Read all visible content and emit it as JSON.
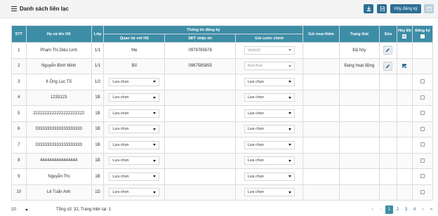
{
  "header": {
    "title": "Danh sách liên lạc",
    "buttons": {
      "cancel_label": "Hủy đăng ký"
    }
  },
  "table": {
    "headers": {
      "stt": "STT",
      "name": "Họ và tên HS",
      "class": "Lớp",
      "group": "Thông tin đăng ký",
      "relation": "Quan hệ với HS",
      "phone": "SĐT nhận tin",
      "package": "Gói cước chính",
      "extra": "Gói mua thêm",
      "status": "Trạng thái",
      "edit": "Sửa",
      "cancel": "Hủy Đk",
      "register": "Đăng ký"
    },
    "rows": [
      {
        "stt": "1",
        "name": "Phạm Thị Diệu Linh",
        "class": "1/1",
        "relation": "Mẹ",
        "phone": "0978785678",
        "package": "Viettel3",
        "status": "Đã hủy",
        "edit": true,
        "cancel": "",
        "register": ""
      },
      {
        "stt": "2",
        "name": "Nguyễn Bình Minh",
        "class": "1/1",
        "relation": "Bố",
        "phone": "0987585855",
        "package": "KienTest",
        "status": "Đang hoạt động",
        "edit": true,
        "cancel": "checked",
        "register": ""
      },
      {
        "stt": "3",
        "name": "6 Ông Lục Tổ",
        "class": "1/2",
        "relation_select": "Lựa chọn",
        "package_select": "Lựa chọn",
        "register": "box"
      },
      {
        "stt": "4",
        "name": "1233123",
        "class": "1B",
        "relation_select": "Lựa chọn",
        "package_select": "Lựa chọn",
        "register": "box"
      },
      {
        "stt": "5",
        "name": "2222222222222222222222",
        "class": "1B",
        "relation_select": "Lựa chọn",
        "package_select": "Lựa chọn",
        "register": "box"
      },
      {
        "stt": "6",
        "name": "33333333333333333333",
        "class": "1B",
        "relation_select": "Lựa chọn",
        "package_select": "Lựa chọn",
        "register": "box"
      },
      {
        "stt": "7",
        "name": "33333333333333333333",
        "class": "1B",
        "relation_select": "Lựa chọn",
        "package_select": "Lựa chọn",
        "register": "box"
      },
      {
        "stt": "8",
        "name": "4444444444444444",
        "class": "1B",
        "relation_select": "Lựa chọn",
        "package_select": "Lựa chọn",
        "register": "box"
      },
      {
        "stt": "9",
        "name": "Nguyễn Thị",
        "class": "1B",
        "relation_select": "Lựa chọn",
        "package_select": "Lựa chọn",
        "register": "box"
      },
      {
        "stt": "10",
        "name": "Lê Tuấn Anh",
        "class": "1D",
        "relation_select": "Lựa chọn",
        "package_select": "Lựa chọn",
        "register": "box"
      }
    ]
  },
  "footer": {
    "page_size": "10",
    "summary": "Tổng số: 32, Trang hiện tại: 1",
    "pages": [
      "1",
      "2",
      "3",
      "4"
    ],
    "current_page": "1"
  },
  "colors": {
    "header_bg": "#3e8da7",
    "button_bg": "#2b6f96"
  }
}
